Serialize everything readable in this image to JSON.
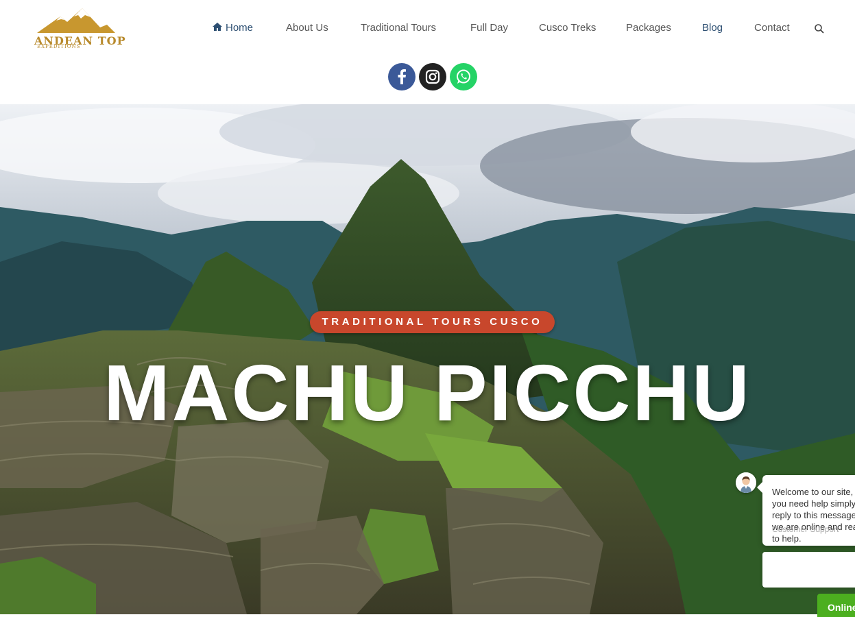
{
  "brand": {
    "name": "ANDEAN TOP",
    "tagline": "EXPEDITIONS",
    "logo_color": "#b88a2c"
  },
  "nav": {
    "home": "Home",
    "items": [
      "About Us",
      "Traditional Tours",
      "Full Day",
      "Cusco Treks",
      "Packages",
      "Blog",
      "Contact"
    ],
    "active_color": "#2d4f72"
  },
  "social": {
    "facebook_color": "#3b5998",
    "instagram_color": "#222222",
    "whatsapp_color": "#25d366"
  },
  "hero": {
    "badge": "TRADITIONAL TOURS CUSCO",
    "title": "MACHU PICCHU",
    "badge_color": "#c8472c"
  },
  "chat": {
    "message": "Welcome to our site, if you need help simply reply to this message, we are online and ready to help.",
    "sender": "Customer Support",
    "status": "Online",
    "status_color": "#4caf1f"
  },
  "icons": {
    "home": "home-icon",
    "search": "search-icon",
    "facebook": "facebook-icon",
    "instagram": "instagram-icon",
    "whatsapp": "whatsapp-icon"
  }
}
